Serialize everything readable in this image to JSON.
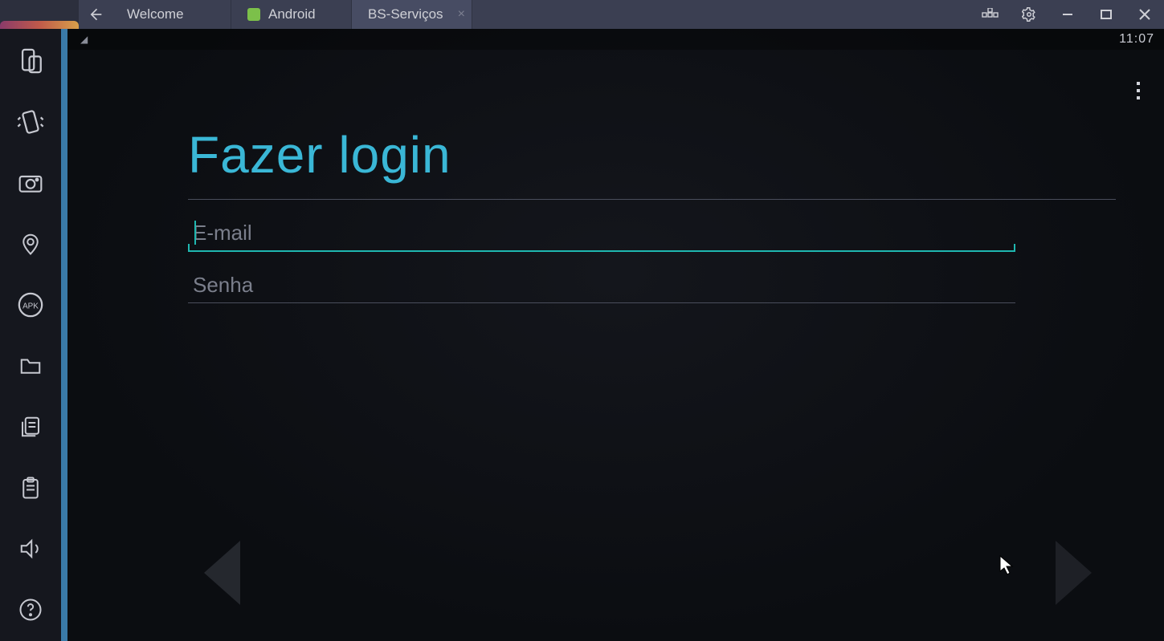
{
  "titlebar": {
    "tabs": [
      {
        "label": "Welcome",
        "icon_color": "transparent"
      },
      {
        "label": "Android",
        "icon_color": "#7cc04a"
      },
      {
        "label": "BS-Serviços",
        "icon_color": "transparent"
      }
    ]
  },
  "statusbar": {
    "clock": "11:07"
  },
  "login": {
    "title": "Fazer login",
    "email_placeholder": "E-mail",
    "email_value": "",
    "password_placeholder": "Senha",
    "password_value": ""
  },
  "sidebar_icons": [
    "orientation-icon",
    "shake-icon",
    "camera-icon",
    "location-icon",
    "apk-icon",
    "folder-icon",
    "copy-icon",
    "paste-icon",
    "volume-icon",
    "help-icon"
  ]
}
